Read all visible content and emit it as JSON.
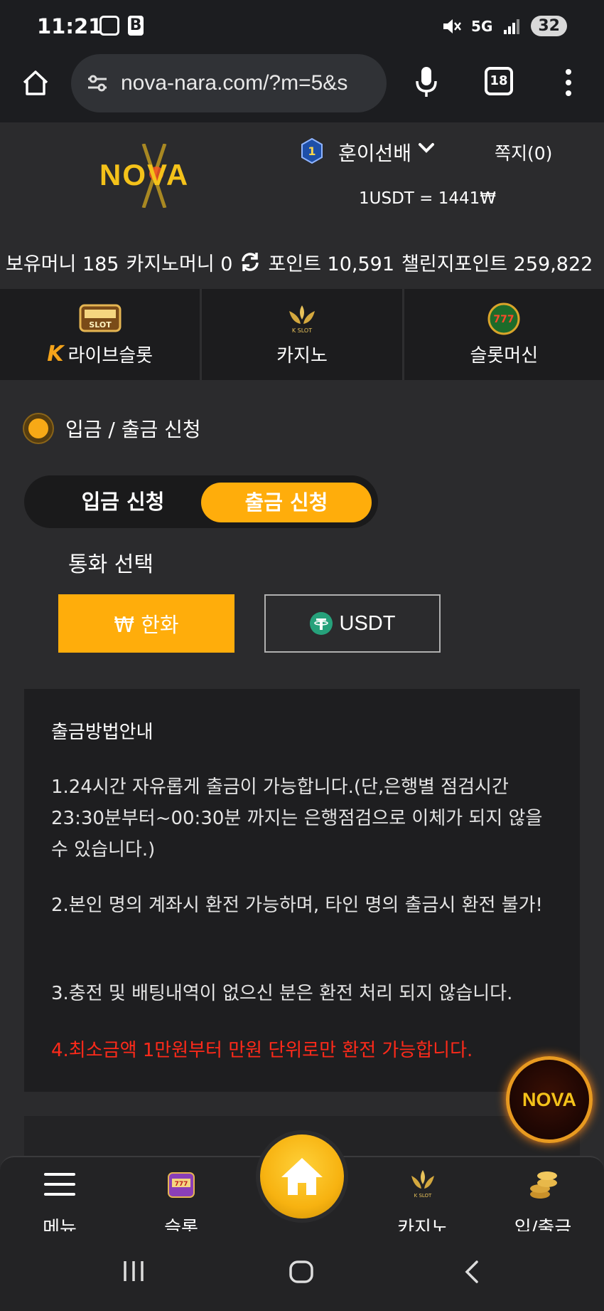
{
  "status_bar": {
    "time": "11:21",
    "b_icon": "B",
    "network": "5G",
    "battery": "32"
  },
  "browser": {
    "url": "nova-nara.com/?m=5&s",
    "tab_count": "18"
  },
  "header": {
    "logo_text": "NOVA",
    "rank": "1",
    "username": "훈이선배",
    "messages": "쪽지(0)",
    "rate": "1USDT = 1441₩"
  },
  "balances": {
    "holding": "보유머니 185",
    "casino": "카지노머니 0",
    "points": "포인트 10,591",
    "challenge": "챌린지포인트 259,822"
  },
  "categories": [
    {
      "label": "라이브슬롯",
      "icon": "live-slot-icon"
    },
    {
      "label": "카지노",
      "icon": "k-slot-icon"
    },
    {
      "label": "슬롯머신",
      "icon": "777-slots-icon"
    }
  ],
  "section": {
    "title": "입금 / 출금 신청"
  },
  "toggle": {
    "deposit": "입금 신청",
    "withdraw": "출금 신청"
  },
  "currency": {
    "label": "통화 선택",
    "krw": "₩ 한화",
    "usdt": "USDT"
  },
  "guide": {
    "title": "출금방법안내",
    "line1": "1.24시간 자유롭게 출금이 가능합니다.(단,은행별 점검시간 23:30분부터~00:30분 까지는 은행점검으로 이체가 되지 않을 수 있습니다.)",
    "line2": "2.본인 명의 계좌시 환전 가능하며, 타인 명의 출금시 환전 불가!",
    "line3": "3.충전 및 배팅내역이 없으신 분은 환전 처리 되지 않습니다.",
    "line4": "4.최소금액 1만원부터 만원 단위로만 환전 가능합니다."
  },
  "float_button": {
    "text": "NOVA"
  },
  "bottom_nav": {
    "menu": "메뉴",
    "slot": "슬롯",
    "casino": "카지노",
    "inout": "입/출금"
  },
  "colors": {
    "accent": "#ffad0b",
    "warning": "#ff2a1a",
    "bg": "#2b2b2d"
  }
}
